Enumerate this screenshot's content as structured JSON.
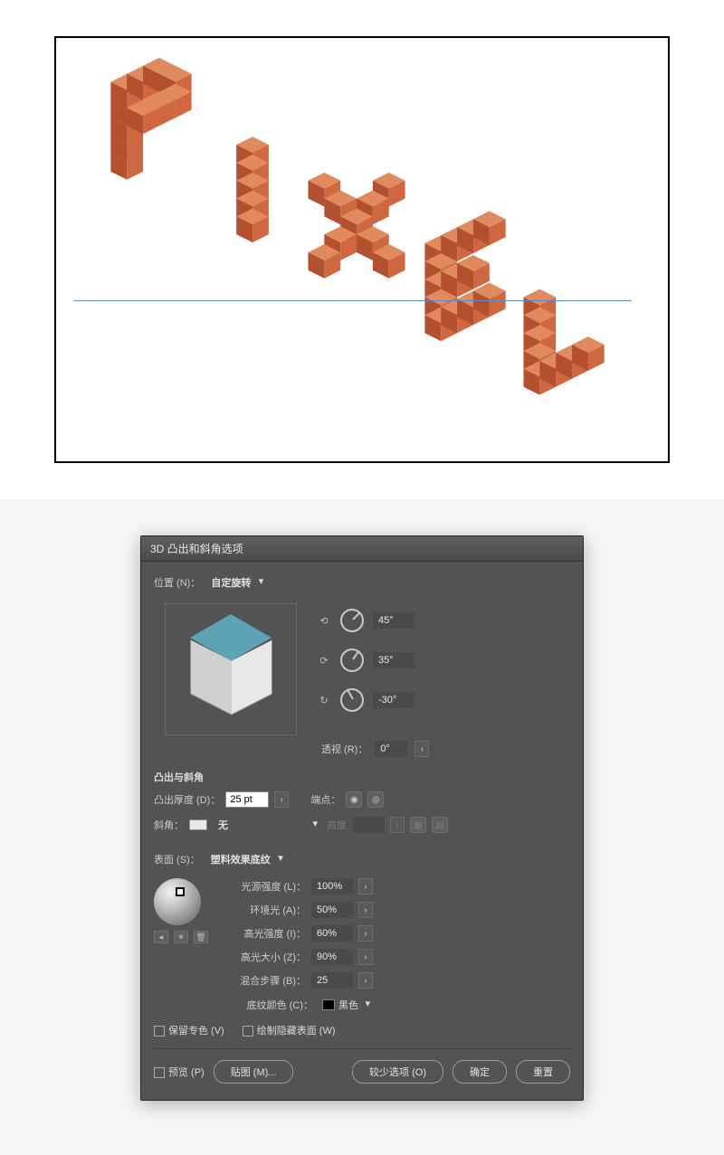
{
  "dialog": {
    "title": "3D 凸出和斜角选项",
    "position_label": "位置 (N)：",
    "position_value": "自定旋转",
    "angles": {
      "x": "45°",
      "y": "35°",
      "z": "-30°"
    },
    "perspective_label": "透视 (R)：",
    "perspective_value": "0°",
    "extrude": {
      "section": "凸出与斜角",
      "depth_label": "凸出厚度 (D)：",
      "depth_value": "25 pt",
      "cap_label": "端点：",
      "bevel_label": "斜角：",
      "bevel_value": "无",
      "height_label": "高度",
      "height_value": ""
    },
    "surface": {
      "label": "表面 (S)：",
      "value": "塑料效果底纹",
      "light_intensity_label": "光源强度 (L)：",
      "light_intensity_value": "100%",
      "ambient_label": "环境光 (A)：",
      "ambient_value": "50%",
      "highlight_intensity_label": "高光强度 (I)：",
      "highlight_intensity_value": "60%",
      "highlight_size_label": "高光大小 (Z)：",
      "highlight_size_value": "90%",
      "blend_steps_label": "混合步骤 (B)：",
      "blend_steps_value": "25",
      "shade_color_label": "底纹颜色 (C)：",
      "shade_color_value": "黑色"
    },
    "preserve_spot_label": "保留专色 (V)",
    "draw_hidden_label": "绘制隐藏表面 (W)",
    "preview_label": "预览 (P)",
    "buttons": {
      "map_art": "贴图 (M)...",
      "fewer_options": "较少选项 (O)",
      "ok": "确定",
      "reset": "重置"
    }
  },
  "chart_data": {
    "type": "illustration",
    "description": "Isometric 3D pixel-block letters spelling PIXEL rendered in orange on a white canvas with a blue horizontal guide, plus an Adobe Illustrator '3D Extrude & Bevel Options' dialog below.",
    "text_depicted": "PIXEL",
    "colors": {
      "block_top": "#e08a5e",
      "block_left": "#b35030",
      "block_right": "#cf6841",
      "guide": "#5a8cc9",
      "cube_preview_top": "#5ea3b5"
    }
  }
}
